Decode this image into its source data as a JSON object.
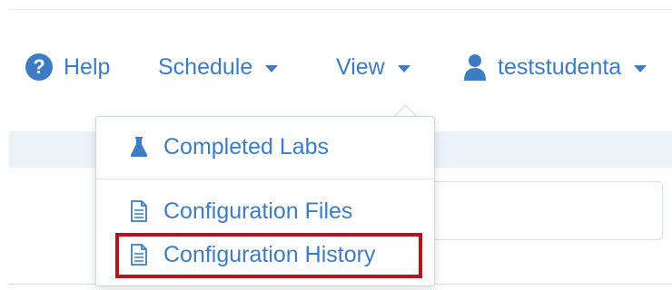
{
  "navbar": {
    "help_label": "Help",
    "schedule_label": "Schedule",
    "view_label": "View",
    "user_label": "teststudenta"
  },
  "view_menu": {
    "items": [
      {
        "label": "Completed Labs",
        "icon": "flask-icon"
      },
      {
        "label": "Configuration Files",
        "icon": "file-icon"
      },
      {
        "label": "Configuration History",
        "icon": "file-icon",
        "highlighted": true
      }
    ]
  },
  "colors": {
    "accent": "#3c7cc5",
    "highlight_border": "#b3141b",
    "subbar": "#edf2f9"
  }
}
